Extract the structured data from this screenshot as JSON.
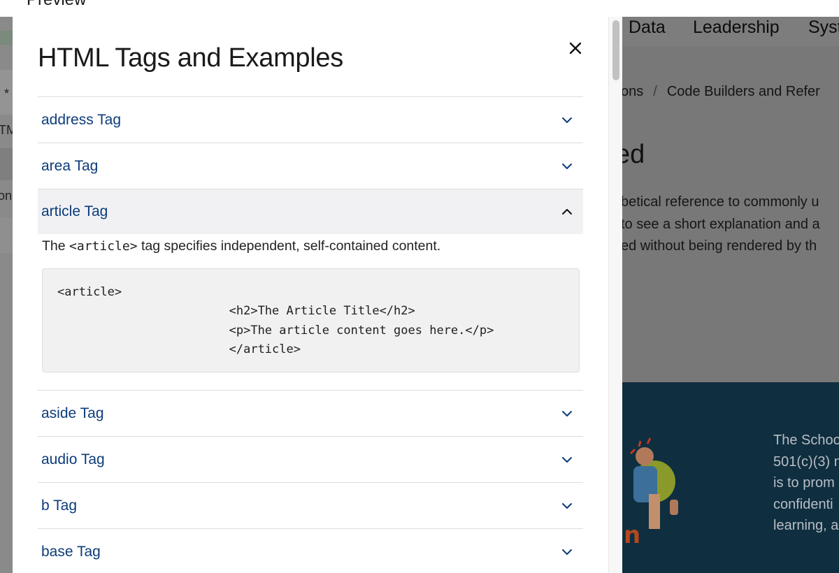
{
  "preview_bar": {
    "title": "Preview"
  },
  "background_page": {
    "left_fragments": [
      "*",
      "TM",
      "on"
    ],
    "nav_items": [
      "Data",
      "Leadership",
      "Syst"
    ],
    "breadcrumb": {
      "prev": "tions",
      "separator": "/",
      "current": "Code Builders and Refer"
    },
    "heading_fragment": "ed",
    "intro_lines": [
      "betical reference to commonly u",
      "to see a short explanation and a",
      "ed without being rendered by th"
    ],
    "footer_lines": [
      "The Schoo",
      "501(c)(3) n",
      "is to prom",
      "confidenti",
      "learning, a"
    ],
    "footer_art_letter": "n"
  },
  "modal": {
    "title": "HTML Tags and Examples",
    "close_icon": "close-icon",
    "accordion": [
      {
        "label": "address Tag",
        "expanded": false,
        "icon": "chevron-down-icon"
      },
      {
        "label": "area Tag",
        "expanded": false,
        "icon": "chevron-down-icon"
      },
      {
        "label": "article Tag",
        "expanded": true,
        "icon": "chevron-up-icon",
        "description_before": "The ",
        "description_code": "<article>",
        "description_after": " tag specifies independent, self-contained content.",
        "example_code": "<article>\n                        <h2>The Article Title</h2>\n                        <p>The article content goes here.</p>\n                        </article>"
      },
      {
        "label": "aside Tag",
        "expanded": false,
        "icon": "chevron-down-icon"
      },
      {
        "label": "audio Tag",
        "expanded": false,
        "icon": "chevron-down-icon"
      },
      {
        "label": "b Tag",
        "expanded": false,
        "icon": "chevron-down-icon"
      },
      {
        "label": "base Tag",
        "expanded": false,
        "icon": "chevron-down-icon"
      }
    ]
  },
  "colors": {
    "link_blue": "#0c3c7a",
    "overlay_gray": "#787878",
    "footer_navy": "#0f2e3f"
  }
}
